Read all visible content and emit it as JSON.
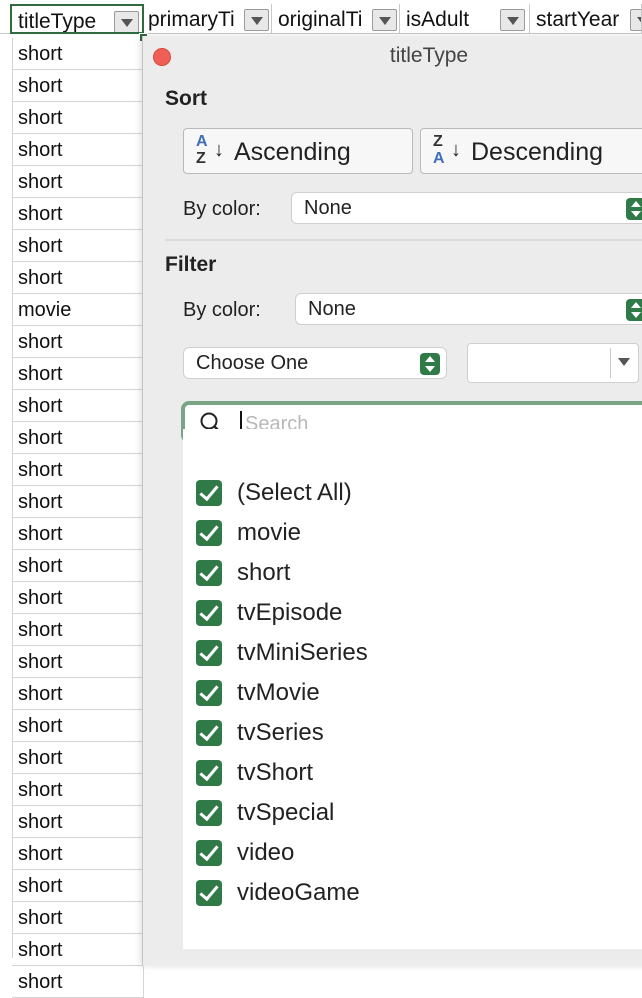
{
  "headers": [
    {
      "label": "titleType"
    },
    {
      "label": "primaryTi"
    },
    {
      "label": "originalTi"
    },
    {
      "label": "isAdult"
    },
    {
      "label": "startYear"
    }
  ],
  "column_cells": [
    "short",
    "short",
    "short",
    "short",
    "short",
    "short",
    "short",
    "short",
    "movie",
    "short",
    "short",
    "short",
    "short",
    "short",
    "short",
    "short",
    "short",
    "short",
    "short",
    "short",
    "short",
    "short",
    "short",
    "short",
    "short",
    "short",
    "short",
    "short",
    "short",
    "short"
  ],
  "popover": {
    "title": "titleType",
    "sort": {
      "heading": "Sort",
      "ascending_label": "Ascending",
      "descending_label": "Descending",
      "by_color_label": "By color:",
      "by_color_value": "None"
    },
    "filter": {
      "heading": "Filter",
      "by_color_label": "By color:",
      "by_color_value": "None",
      "condition_value": "Choose One",
      "condition_text": "",
      "search_placeholder": "Search"
    },
    "items": [
      {
        "label": "(Select All)",
        "checked": true
      },
      {
        "label": "movie",
        "checked": true
      },
      {
        "label": "short",
        "checked": true
      },
      {
        "label": "tvEpisode",
        "checked": true
      },
      {
        "label": "tvMiniSeries",
        "checked": true
      },
      {
        "label": "tvMovie",
        "checked": true
      },
      {
        "label": "tvSeries",
        "checked": true
      },
      {
        "label": "tvShort",
        "checked": true
      },
      {
        "label": "tvSpecial",
        "checked": true
      },
      {
        "label": "video",
        "checked": true
      },
      {
        "label": "videoGame",
        "checked": true
      }
    ]
  },
  "colors": {
    "accent_green": "#2f7a47",
    "close_red": "#ef5f57",
    "selection_border": "#2f6b3e"
  }
}
